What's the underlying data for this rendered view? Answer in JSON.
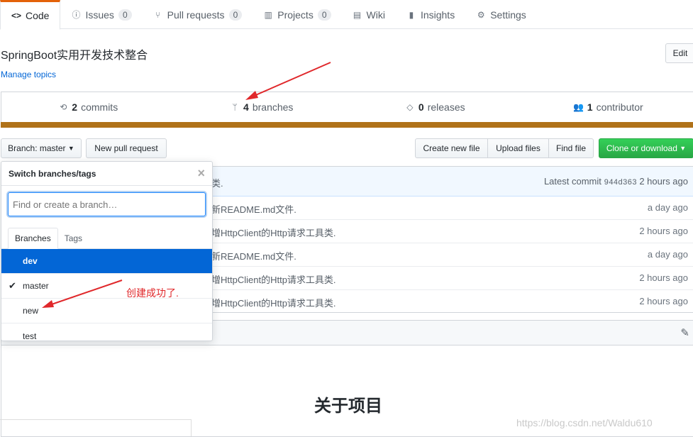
{
  "tabs": [
    {
      "label": "Code",
      "icon": "code-icon"
    },
    {
      "label": "Issues",
      "count": "0",
      "icon": "issue-icon"
    },
    {
      "label": "Pull requests",
      "count": "0",
      "icon": "pull-request-icon"
    },
    {
      "label": "Projects",
      "count": "0",
      "icon": "project-icon"
    },
    {
      "label": "Wiki",
      "icon": "book-icon"
    },
    {
      "label": "Insights",
      "icon": "graph-icon"
    },
    {
      "label": "Settings",
      "icon": "gear-icon"
    }
  ],
  "repo": {
    "description": "SpringBoot实用开发技术整合",
    "manage_topics": "Manage topics",
    "edit": "Edit"
  },
  "summary": {
    "commits_n": "2",
    "commits": "commits",
    "branches_n": "4",
    "branches": "branches",
    "releases_n": "0",
    "releases": "releases",
    "contributors_n": "1",
    "contributors": "contributor"
  },
  "toolbar": {
    "branch": "Branch: master",
    "new_pr": "New pull request",
    "create_file": "Create new file",
    "upload": "Upload files",
    "find": "Find file",
    "clone": "Clone or download"
  },
  "latest_commit": {
    "msg_tail": "类.",
    "label": "Latest commit",
    "sha": "944d363",
    "age": "2 hours ago"
  },
  "files": [
    {
      "msg": "新README.md文件.",
      "age": "a day ago"
    },
    {
      "msg": "增HttpClient的Http请求工具类.",
      "age": "2 hours ago"
    },
    {
      "msg": "新README.md文件.",
      "age": "a day ago"
    },
    {
      "msg": "增HttpClient的Http请求工具类.",
      "age": "2 hours ago"
    },
    {
      "msg": "增HttpClient的Http请求工具类.",
      "age": "2 hours ago"
    }
  ],
  "dropdown": {
    "title": "Switch branches/tags",
    "placeholder": "Find or create a branch…",
    "tab_branches": "Branches",
    "tab_tags": "Tags",
    "items": [
      "dev",
      "master",
      "new",
      "test"
    ]
  },
  "annotation": "创建成功了.",
  "readme": {
    "heading": "关于项目"
  },
  "watermark": "https://blog.csdn.net/Waldu610"
}
